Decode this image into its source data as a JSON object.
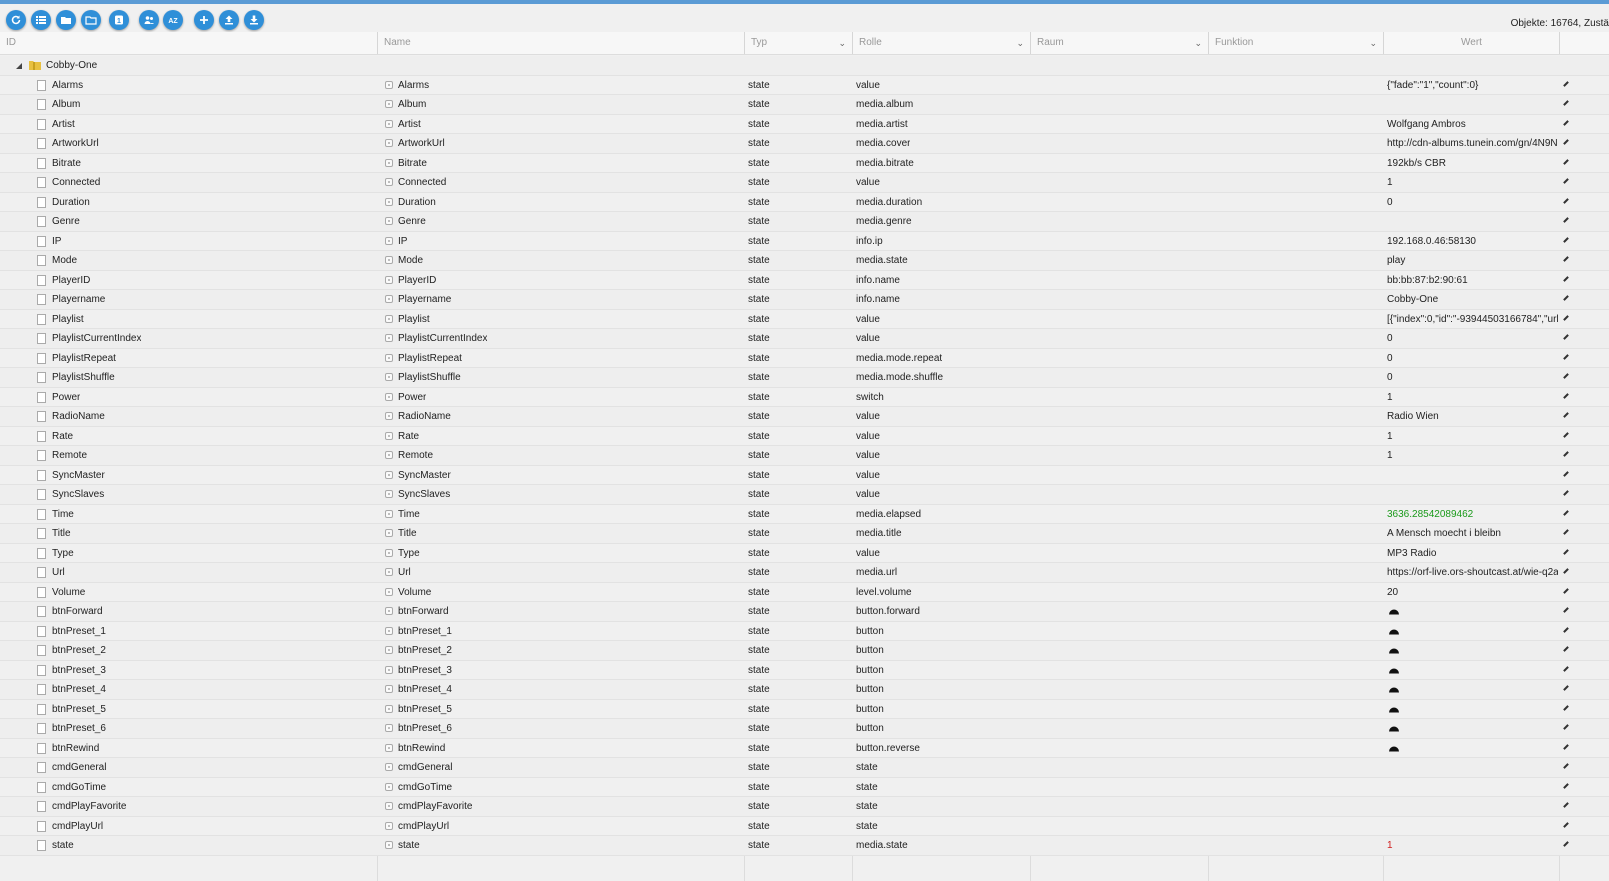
{
  "toolbar": {
    "buttons": [
      "refresh-icon",
      "list-icon",
      "folder-closed-icon",
      "folder-open-icon",
      "number-one-icon",
      "users-icon",
      "sort-az-icon",
      "add-icon",
      "upload-icon",
      "download-icon"
    ],
    "object_count": "Objekte: 16764, Zustä"
  },
  "columns": {
    "id": "ID",
    "name": "Name",
    "typ": "Typ",
    "rolle": "Rolle",
    "raum": "Raum",
    "funktion": "Funktion",
    "wert": "Wert"
  },
  "root": {
    "label": "Cobby-One"
  },
  "rows": [
    {
      "id": "Alarms",
      "name": "Alarms",
      "typ": "state",
      "rolle": "value",
      "wert": "{\"fade\":\"1\",\"count\":0}"
    },
    {
      "id": "Album",
      "name": "Album",
      "typ": "state",
      "rolle": "media.album",
      "wert": ""
    },
    {
      "id": "Artist",
      "name": "Artist",
      "typ": "state",
      "rolle": "media.artist",
      "wert": "Wolfgang Ambros"
    },
    {
      "id": "ArtworkUrl",
      "name": "ArtworkUrl",
      "typ": "state",
      "rolle": "media.cover",
      "wert": "http://cdn-albums.tunein.com/gn/4N9N"
    },
    {
      "id": "Bitrate",
      "name": "Bitrate",
      "typ": "state",
      "rolle": "media.bitrate",
      "wert": "192kb/s CBR"
    },
    {
      "id": "Connected",
      "name": "Connected",
      "typ": "state",
      "rolle": "value",
      "wert": "1"
    },
    {
      "id": "Duration",
      "name": "Duration",
      "typ": "state",
      "rolle": "media.duration",
      "wert": "0"
    },
    {
      "id": "Genre",
      "name": "Genre",
      "typ": "state",
      "rolle": "media.genre",
      "wert": ""
    },
    {
      "id": "IP",
      "name": "IP",
      "typ": "state",
      "rolle": "info.ip",
      "wert": "192.168.0.46:58130"
    },
    {
      "id": "Mode",
      "name": "Mode",
      "typ": "state",
      "rolle": "media.state",
      "wert": "play"
    },
    {
      "id": "PlayerID",
      "name": "PlayerID",
      "typ": "state",
      "rolle": "info.name",
      "wert": "bb:bb:87:b2:90:61"
    },
    {
      "id": "Playername",
      "name": "Playername",
      "typ": "state",
      "rolle": "info.name",
      "wert": "Cobby-One"
    },
    {
      "id": "Playlist",
      "name": "Playlist",
      "typ": "state",
      "rolle": "value",
      "wert": "[{\"index\":0,\"id\":\"-93944503166784\",\"url\":\""
    },
    {
      "id": "PlaylistCurrentIndex",
      "name": "PlaylistCurrentIndex",
      "typ": "state",
      "rolle": "value",
      "wert": "0"
    },
    {
      "id": "PlaylistRepeat",
      "name": "PlaylistRepeat",
      "typ": "state",
      "rolle": "media.mode.repeat",
      "wert": "0"
    },
    {
      "id": "PlaylistShuffle",
      "name": "PlaylistShuffle",
      "typ": "state",
      "rolle": "media.mode.shuffle",
      "wert": "0"
    },
    {
      "id": "Power",
      "name": "Power",
      "typ": "state",
      "rolle": "switch",
      "wert": "1"
    },
    {
      "id": "RadioName",
      "name": "RadioName",
      "typ": "state",
      "rolle": "value",
      "wert": "Radio Wien"
    },
    {
      "id": "Rate",
      "name": "Rate",
      "typ": "state",
      "rolle": "value",
      "wert": "1"
    },
    {
      "id": "Remote",
      "name": "Remote",
      "typ": "state",
      "rolle": "value",
      "wert": "1"
    },
    {
      "id": "SyncMaster",
      "name": "SyncMaster",
      "typ": "state",
      "rolle": "value",
      "wert": ""
    },
    {
      "id": "SyncSlaves",
      "name": "SyncSlaves",
      "typ": "state",
      "rolle": "value",
      "wert": ""
    },
    {
      "id": "Time",
      "name": "Time",
      "typ": "state",
      "rolle": "media.elapsed",
      "wert": "3636.28542089462",
      "color": "green"
    },
    {
      "id": "Title",
      "name": "Title",
      "typ": "state",
      "rolle": "media.title",
      "wert": "A Mensch moecht i bleibn"
    },
    {
      "id": "Type",
      "name": "Type",
      "typ": "state",
      "rolle": "value",
      "wert": "MP3 Radio"
    },
    {
      "id": "Url",
      "name": "Url",
      "typ": "state",
      "rolle": "media.url",
      "wert": "https://orf-live.ors-shoutcast.at/wie-q2a?"
    },
    {
      "id": "Volume",
      "name": "Volume",
      "typ": "state",
      "rolle": "level.volume",
      "wert": "20"
    },
    {
      "id": "btnForward",
      "name": "btnForward",
      "typ": "state",
      "rolle": "button.forward",
      "wert": "",
      "button": true
    },
    {
      "id": "btnPreset_1",
      "name": "btnPreset_1",
      "typ": "state",
      "rolle": "button",
      "wert": "",
      "button": true
    },
    {
      "id": "btnPreset_2",
      "name": "btnPreset_2",
      "typ": "state",
      "rolle": "button",
      "wert": "",
      "button": true
    },
    {
      "id": "btnPreset_3",
      "name": "btnPreset_3",
      "typ": "state",
      "rolle": "button",
      "wert": "",
      "button": true
    },
    {
      "id": "btnPreset_4",
      "name": "btnPreset_4",
      "typ": "state",
      "rolle": "button",
      "wert": "",
      "button": true
    },
    {
      "id": "btnPreset_5",
      "name": "btnPreset_5",
      "typ": "state",
      "rolle": "button",
      "wert": "",
      "button": true
    },
    {
      "id": "btnPreset_6",
      "name": "btnPreset_6",
      "typ": "state",
      "rolle": "button",
      "wert": "",
      "button": true
    },
    {
      "id": "btnRewind",
      "name": "btnRewind",
      "typ": "state",
      "rolle": "button.reverse",
      "wert": "",
      "button": true
    },
    {
      "id": "cmdGeneral",
      "name": "cmdGeneral",
      "typ": "state",
      "rolle": "state",
      "wert": ""
    },
    {
      "id": "cmdGoTime",
      "name": "cmdGoTime",
      "typ": "state",
      "rolle": "state",
      "wert": ""
    },
    {
      "id": "cmdPlayFavorite",
      "name": "cmdPlayFavorite",
      "typ": "state",
      "rolle": "state",
      "wert": ""
    },
    {
      "id": "cmdPlayUrl",
      "name": "cmdPlayUrl",
      "typ": "state",
      "rolle": "state",
      "wert": ""
    },
    {
      "id": "state",
      "name": "state",
      "typ": "state",
      "rolle": "media.state",
      "wert": "1",
      "color": "red"
    }
  ]
}
